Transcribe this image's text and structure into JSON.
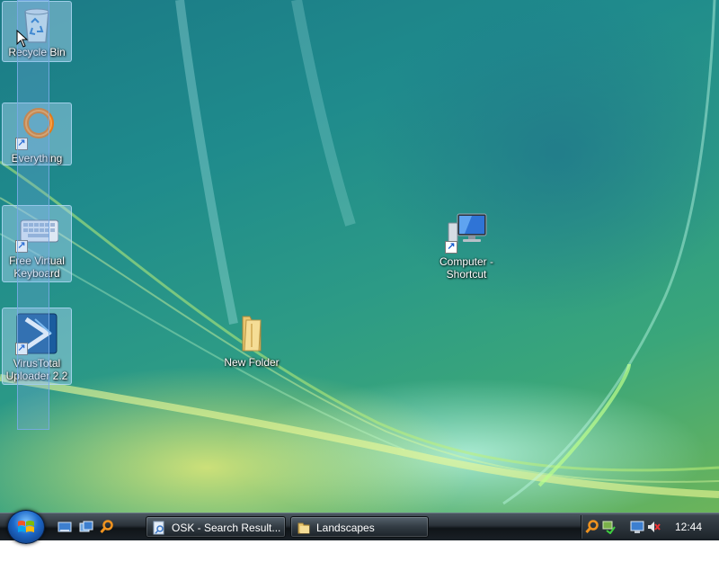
{
  "desktop": {
    "icons": [
      {
        "label": "Recycle Bin",
        "icon": "recycle-bin-icon",
        "selected": true
      },
      {
        "label": "Everything",
        "icon": "everything-search-icon",
        "selected": true,
        "shortcut": true
      },
      {
        "label": "Free Virtual\nKeyboard",
        "icon": "keyboard-icon",
        "selected": true,
        "shortcut": true
      },
      {
        "label": "VirusTotal\nUploader 2.2",
        "icon": "virustotal-icon",
        "selected": true,
        "shortcut": true
      },
      {
        "label": "New Folder",
        "icon": "folder-icon",
        "selected": false
      },
      {
        "label": "Computer -\nShortcut",
        "icon": "computer-icon",
        "selected": false,
        "shortcut": true
      }
    ]
  },
  "taskbar": {
    "start_icon": "windows-start-orb",
    "quick_launch": [
      "show-desktop-icon",
      "switch-windows-icon",
      "search-icon"
    ],
    "buttons": [
      {
        "label": "OSK - Search Result...",
        "icon": "search-results-icon"
      },
      {
        "label": "Landscapes",
        "icon": "folder-icon"
      }
    ],
    "tray": {
      "icons": [
        "search-tray-icon",
        "network-icon",
        "display-icon",
        "volume-muted-icon"
      ],
      "clock": "12:44 PM"
    }
  },
  "colors": {
    "accent": "#1d69c9",
    "taskbar": "#1a2026",
    "selection": "#78aae6"
  }
}
